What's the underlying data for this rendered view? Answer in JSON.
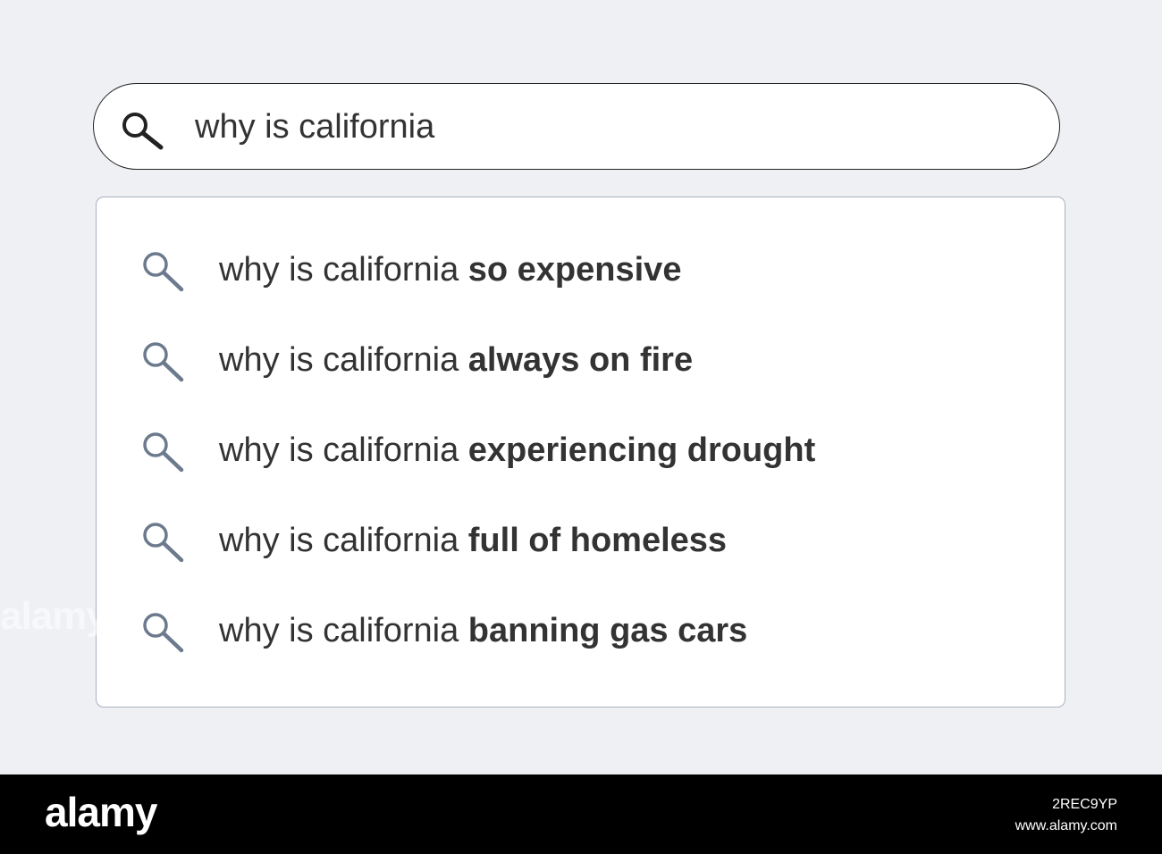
{
  "search": {
    "query": "why is california",
    "icon": "search-icon"
  },
  "suggestions": [
    {
      "prefix": "why is california ",
      "completion": "so expensive"
    },
    {
      "prefix": "why is california ",
      "completion": "always on fire"
    },
    {
      "prefix": "why is california ",
      "completion": "experiencing drought"
    },
    {
      "prefix": "why is california ",
      "completion": "full of homeless"
    },
    {
      "prefix": "why is california ",
      "completion": "banning gas cars"
    }
  ],
  "watermark": "alamy",
  "footer": {
    "brand": "alamy",
    "image_id": "2REC9YP",
    "site": "www.alamy.com"
  },
  "colors": {
    "background": "#eef0f4",
    "text": "#333333",
    "suggestion_icon": "#6b7a8d",
    "search_icon": "#222222",
    "footer": "#000000"
  }
}
